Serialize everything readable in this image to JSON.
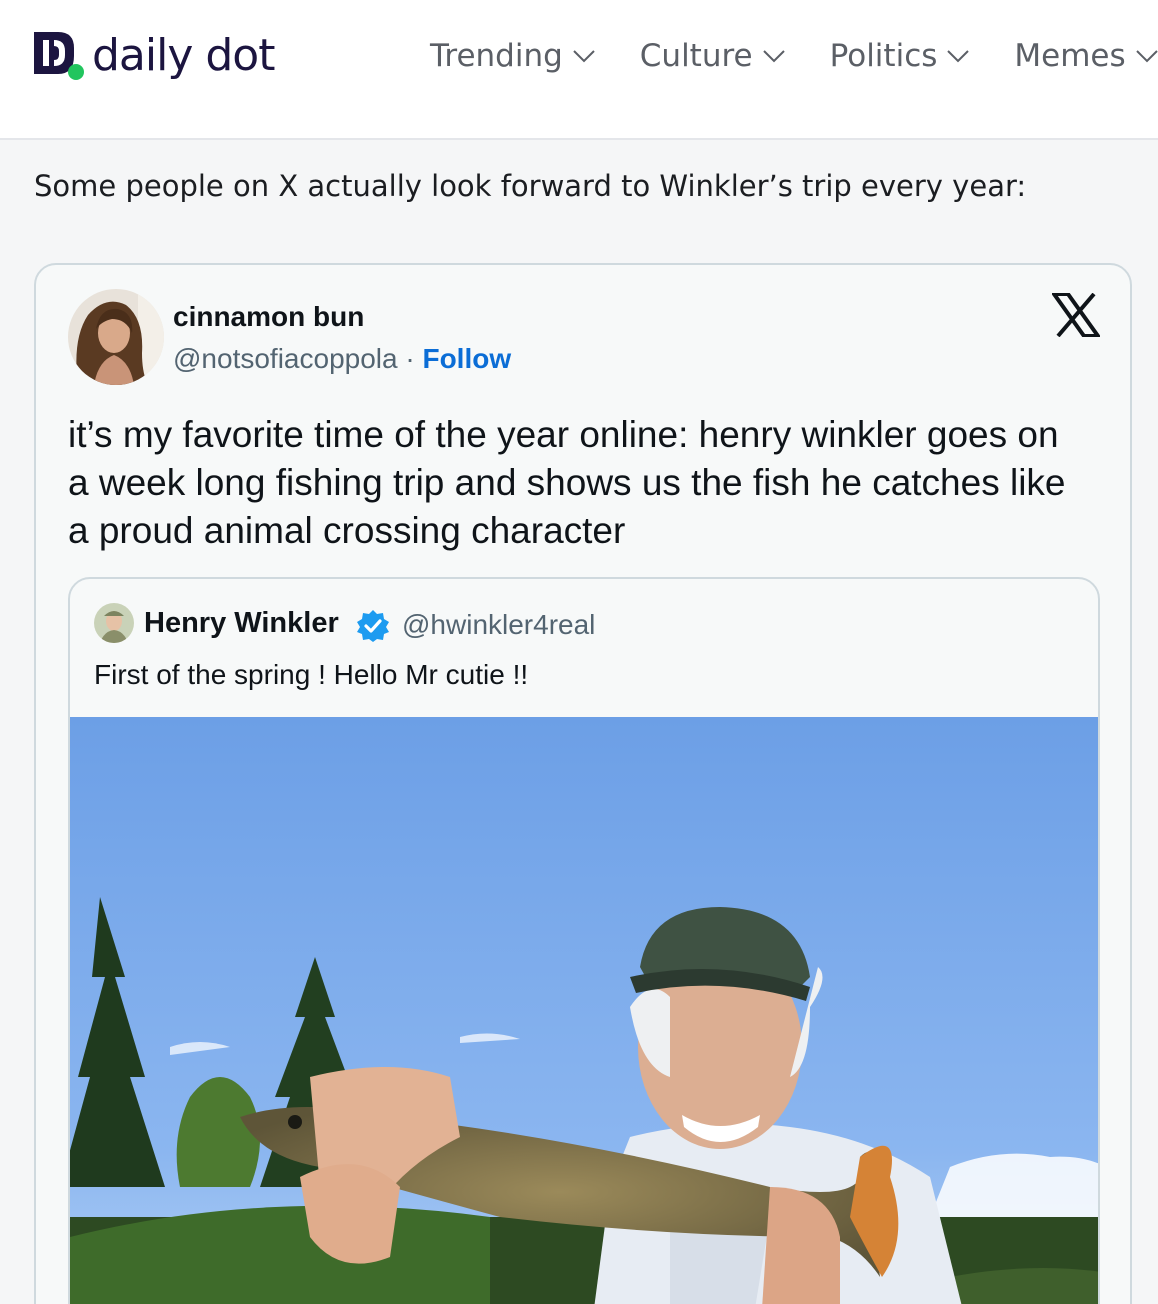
{
  "site": {
    "logo_text": "daily dot",
    "nav": [
      {
        "label": "Trending"
      },
      {
        "label": "Culture"
      },
      {
        "label": "Politics"
      },
      {
        "label": "Memes"
      }
    ]
  },
  "article": {
    "intro": "Some people on X actually look forward to Winkler’s trip every year:"
  },
  "tweet": {
    "author_name": "cinnamon bun",
    "handle": "@notsofiacoppola",
    "separator": " · ",
    "follow_label": "Follow",
    "text": "it’s my favorite time of the year online: henry winkler goes on a week long fishing trip and shows us the fish he catches like a proud animal crossing character",
    "quoted": {
      "author_name": "Henry Winkler",
      "handle": "@hwinkler4real",
      "text": "First of the spring ! Hello Mr cutie !!"
    }
  },
  "icons": {
    "logo": "daily-dot-logo-icon",
    "nav_chevron": "chevron-down-icon",
    "x_logo": "x-logo-icon",
    "verified": "verified-badge-icon"
  },
  "colors": {
    "brand_purple": "#1c1540",
    "brand_green": "#22c55e",
    "follow_blue": "#0b6dd6",
    "verified_blue": "#1d9bf0"
  }
}
